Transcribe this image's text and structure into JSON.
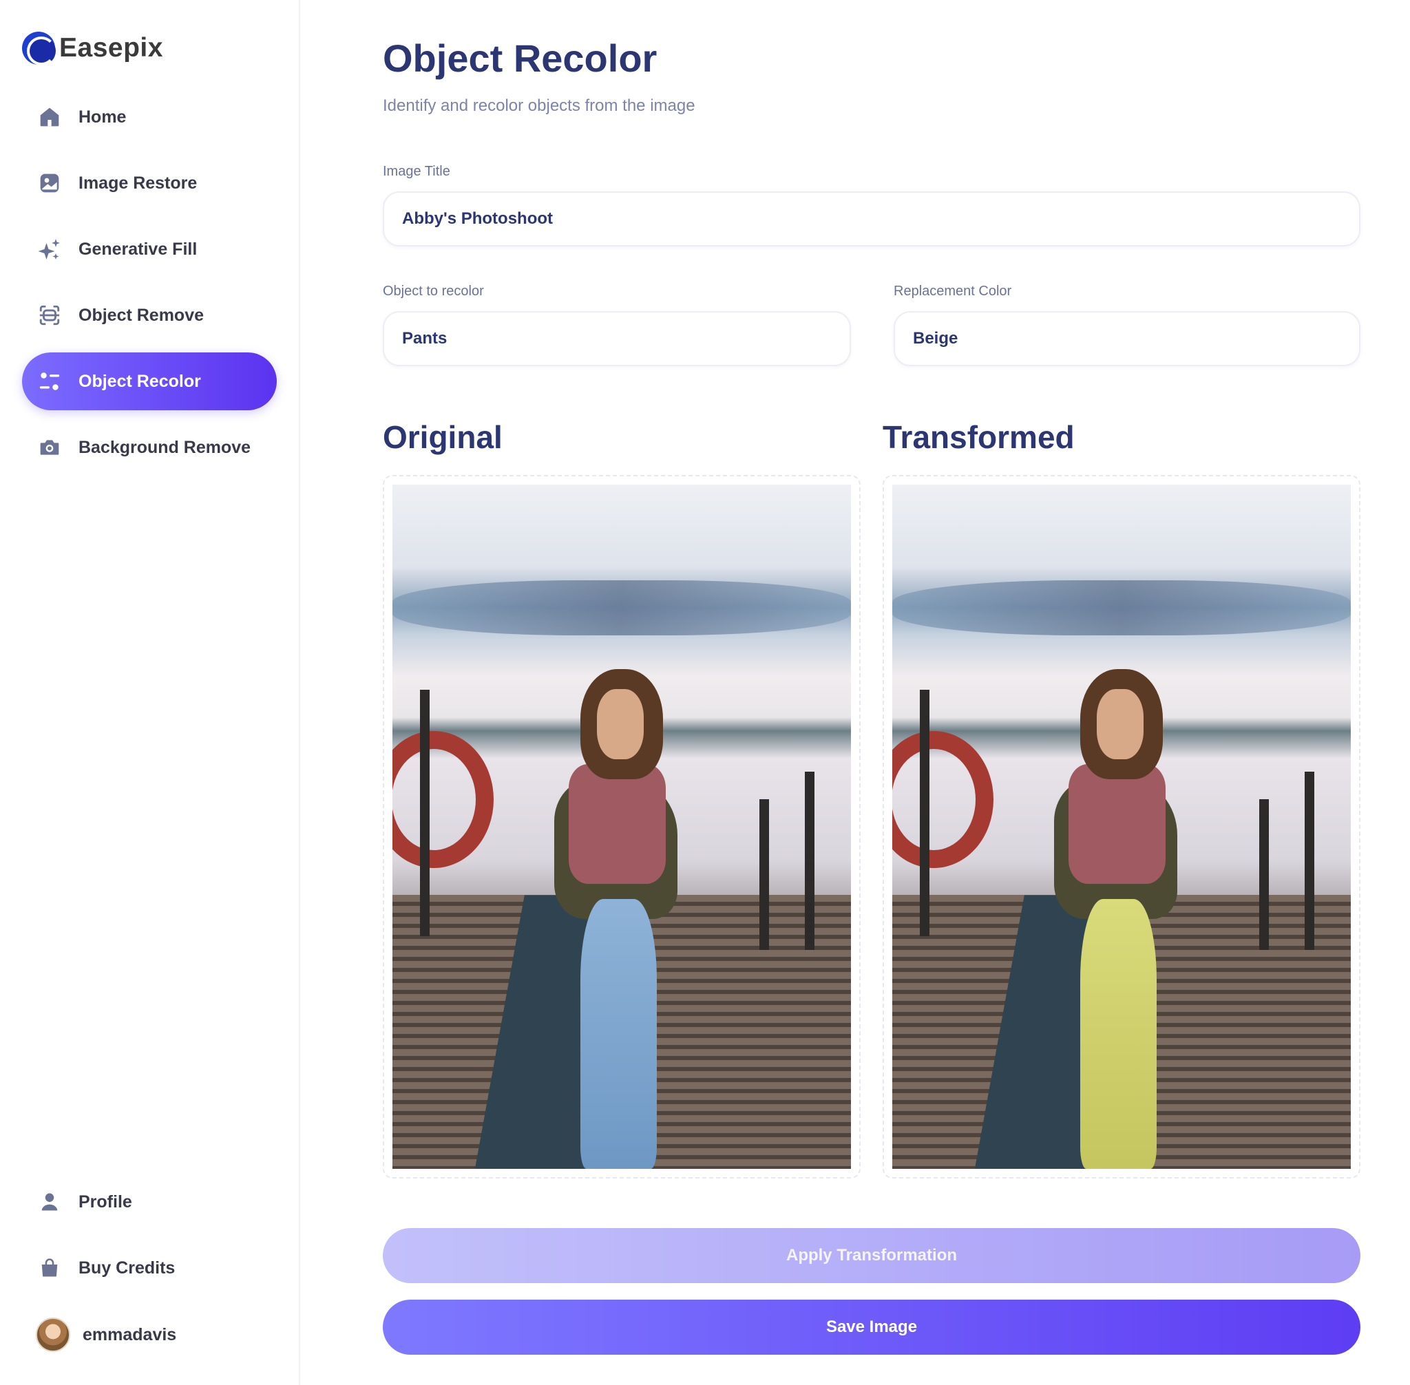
{
  "app": {
    "name": "Easepix",
    "accent": "#5b33f0"
  },
  "sidebar": {
    "items": [
      {
        "label": "Home",
        "icon": "home-icon"
      },
      {
        "label": "Image Restore",
        "icon": "image-icon"
      },
      {
        "label": "Generative Fill",
        "icon": "sparkles-icon"
      },
      {
        "label": "Object Remove",
        "icon": "scan-icon"
      },
      {
        "label": "Object Recolor",
        "icon": "filter-icon",
        "active": true
      },
      {
        "label": "Background Remove",
        "icon": "camera-icon"
      }
    ],
    "bottom_items": [
      {
        "label": "Profile",
        "icon": "user-icon"
      },
      {
        "label": "Buy Credits",
        "icon": "bag-icon"
      }
    ],
    "user": {
      "username": "emmadavis"
    }
  },
  "main": {
    "title": "Object Recolor",
    "subtitle": "Identify and recolor objects from the image",
    "image_title": {
      "label": "Image Title",
      "value": "Abby's Photoshoot"
    },
    "object": {
      "label": "Object to recolor",
      "value": "Pants"
    },
    "color": {
      "label": "Replacement Color",
      "value": "Beige"
    },
    "original_label": "Original",
    "transformed_label": "Transformed",
    "apply_button": "Apply Transformation",
    "save_button": "Save Image"
  }
}
